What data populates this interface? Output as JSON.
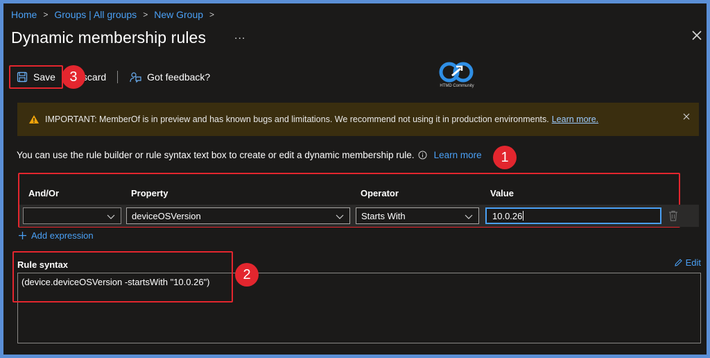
{
  "breadcrumb": {
    "items": [
      "Home",
      "Groups | All groups",
      "New Group"
    ],
    "separator": ">"
  },
  "header": {
    "title": "Dynamic membership rules",
    "more": "..."
  },
  "toolbar": {
    "save_label": "Save",
    "discard_label": "scard",
    "feedback_label": "Got feedback?"
  },
  "logo": {
    "caption": "HTMD Community"
  },
  "banner": {
    "text": "IMPORTANT: MemberOf is in preview and has known bugs and limitations. We recommend not using it in production environments.",
    "link": "Learn more."
  },
  "intro": {
    "text": "You can use the rule builder or rule syntax text box to create or edit a dynamic membership rule.",
    "link": "Learn more"
  },
  "rule_builder": {
    "columns": [
      "And/Or",
      "Property",
      "Operator",
      "Value"
    ],
    "row": {
      "and_or": "",
      "property": "deviceOSVersion",
      "operator": "Starts With",
      "value": "10.0.26"
    },
    "add_expression": "Add expression"
  },
  "rule_syntax": {
    "label": "Rule syntax",
    "edit_label": "Edit",
    "value": "(device.deviceOSVersion -startsWith \"10.0.26\")"
  },
  "annotations": [
    "1",
    "2",
    "3"
  ],
  "colors": {
    "accent": "#4aa0f5",
    "annotation_red": "#e3262e",
    "banner_bg": "#3a2e0f",
    "warning": "#f0a30a",
    "page_bg": "#1b1a19",
    "frame": "#5b8fd6"
  }
}
